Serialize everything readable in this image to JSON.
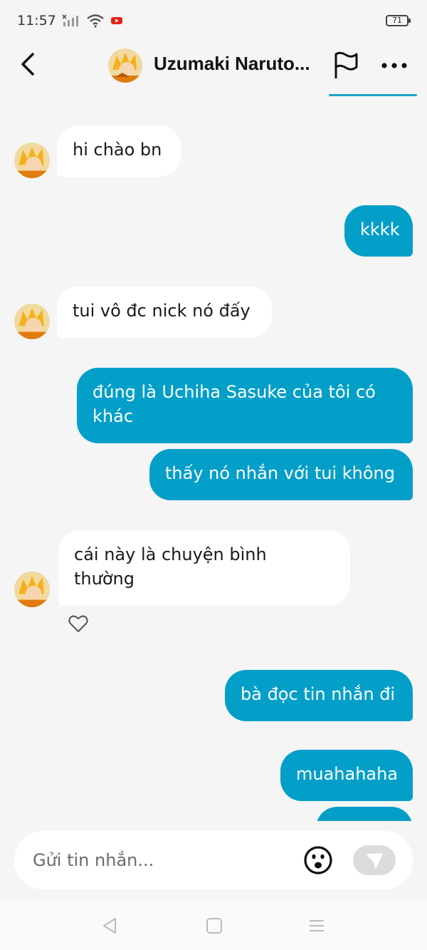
{
  "status": {
    "time": "11:57",
    "battery": "71"
  },
  "header": {
    "title": "Uzumaki Naruto...",
    "back_icon": "chevron-left-icon",
    "flag_icon": "flag-icon",
    "more_icon": "more-horizontal-icon"
  },
  "messages": [
    {
      "side": "in",
      "text": "hi chào bn"
    },
    {
      "side": "out",
      "text": "kkkk"
    },
    {
      "side": "in",
      "text": "tui vô đc nick nó đấy"
    },
    {
      "side": "out",
      "line1": "đúng là Uchiha Sasuke của tôi có",
      "line2": "khác"
    },
    {
      "side": "out",
      "text": "thấy nó nhắn với tui không"
    },
    {
      "side": "in",
      "line1": "cái này là chuyện bình",
      "line2": "thường"
    },
    {
      "side": "out",
      "text": "bà đọc tin nhắn đi"
    },
    {
      "side": "out",
      "text": "muahahaha"
    }
  ],
  "input": {
    "placeholder": "Gửi tin nhắn...",
    "emoji_icon": "emoji-icon",
    "send_icon": "send-icon"
  },
  "colors": {
    "outgoing_bubble": "#049fc9",
    "incoming_bubble": "#ffffff",
    "background": "#f5f5f5"
  }
}
